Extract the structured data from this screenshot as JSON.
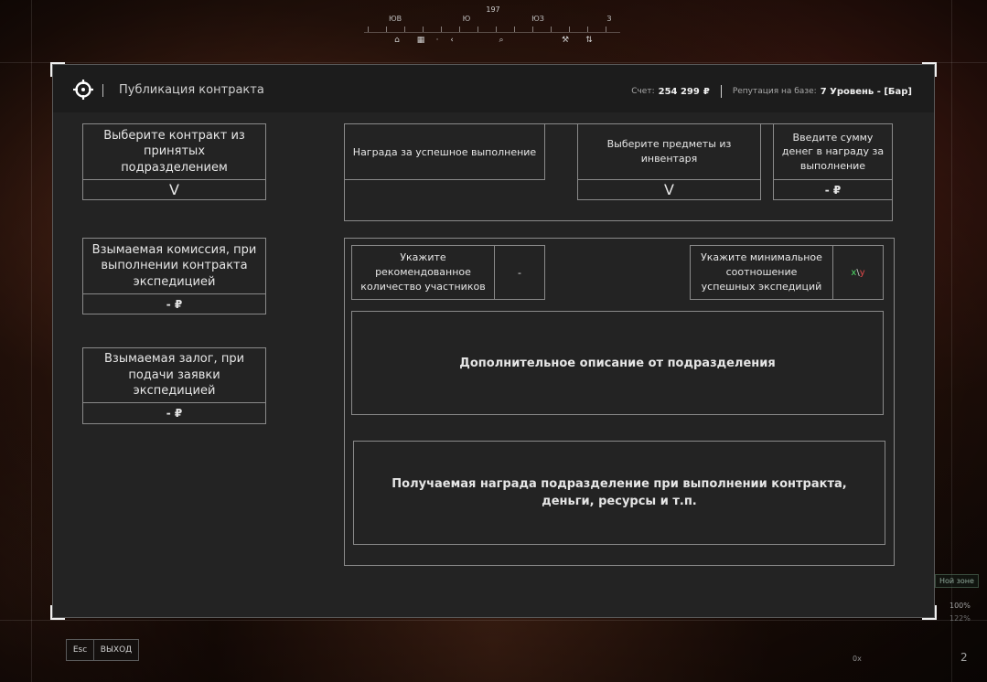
{
  "compass": {
    "heading": "197",
    "labels": [
      "ЮВ",
      "Ю",
      "ЮЗ",
      "З"
    ]
  },
  "panel": {
    "title": "Публикация контракта",
    "account_label": "Счет:",
    "account_value": "254 299",
    "currency_symbol": "₽",
    "reputation_label": "Репутация на базе:",
    "reputation_value": "7 Уровень - [Бар]"
  },
  "left": {
    "contract_select": {
      "label": "Выберите контракт из принятых подразделением",
      "value": "V"
    },
    "commission": {
      "label": "Взымаемая комиссия, при выполнении контракта экспедицией",
      "value": "- ₽"
    },
    "deposit": {
      "label": "Взымаемая залог, при подачи заявки экспедицией",
      "value": "- ₽"
    }
  },
  "reward": {
    "header": "Награда за успешное выполнение",
    "items_label": "Выберите предметы из инвентаря",
    "items_value": "V",
    "money_label": "Введите сумму денег в награду за выполнение",
    "money_value": "- ₽"
  },
  "details": {
    "participants_label": "Укажите рекомендованное количество участников",
    "participants_value": "-",
    "ratio_label": "Укажите минимальное соотношение успешных экспедиций",
    "ratio_value_x": "x",
    "ratio_value_sep": "\\",
    "ratio_value_y": "y",
    "description": "Дополнительное описание от подразделения",
    "division_reward": "Получаемая награда подразделение при выполнении контракта, деньги, ресурсы и т.п."
  },
  "footer": {
    "esc_label": "Esc",
    "exit_label": "ВЫХОД"
  },
  "hud": {
    "zone_text": "Ной зоне",
    "pct_top": "100%",
    "pct_bottom": "122%",
    "ammo": "2",
    "counter": "0x"
  },
  "colors": {
    "ratio_x": "#4cd964",
    "ratio_y": "#e04848",
    "panel_bg": "#232323",
    "header_bg": "#1c1c1c",
    "border": "#8a8a8a"
  }
}
